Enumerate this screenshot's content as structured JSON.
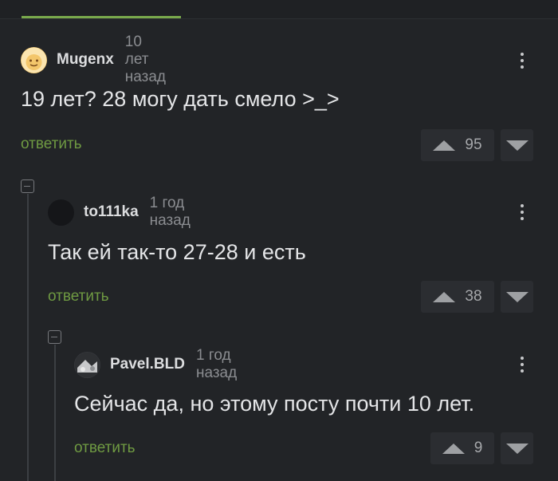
{
  "comments": [
    {
      "username": "Mugenx",
      "time": "10 лет назад",
      "text": "19 лет? 28 могу дать смело >_>",
      "reply_label": "ответить",
      "rating": "95",
      "avatar_color": "#f0c060"
    },
    {
      "username": "to111ka",
      "time": "1 год назад",
      "text": "Так ей так-то 27-28 и есть",
      "reply_label": "ответить",
      "rating": "38",
      "avatar_color": "#151619"
    },
    {
      "username": "Pavel.BLD",
      "time": "1 год назад",
      "text": "Сейчас да, но этому посту почти 10 лет.",
      "reply_label": "ответить",
      "rating": "9",
      "avatar_color": "#3a3c40"
    }
  ],
  "colors": {
    "background": "#222427",
    "accent": "#79a94c",
    "reply_link": "#6f9a42"
  },
  "icons": [
    "more-vertical-icon",
    "upvote-arrow-icon",
    "downvote-arrow-icon",
    "collapse-minus-icon"
  ]
}
